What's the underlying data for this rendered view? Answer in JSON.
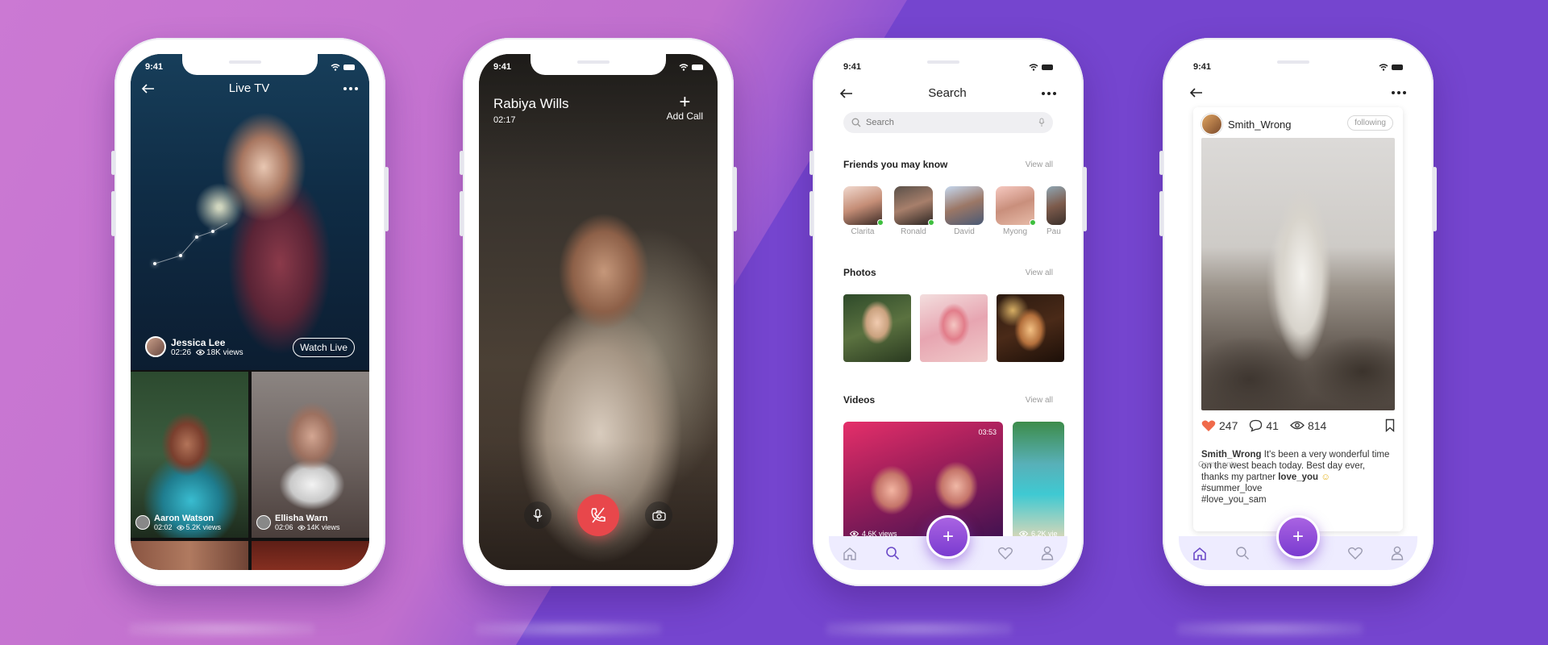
{
  "status_time": "9:41",
  "live_tv": {
    "title": "Live TV",
    "streamer_name": "Jessica Lee",
    "stream_time": "02:26",
    "stream_views": "18K views",
    "watch_label": "Watch Live",
    "tiles": [
      {
        "name": "Aaron Watson",
        "time": "02:02",
        "views": "5.2K views"
      },
      {
        "name": "Ellisha Warn",
        "time": "02:06",
        "views": "14K views"
      }
    ]
  },
  "call": {
    "name": "Rabiya Wills",
    "duration": "02:17",
    "add_call_label": "Add Call"
  },
  "search": {
    "title": "Search",
    "placeholder": "Search",
    "friends_title": "Friends you may know",
    "photos_title": "Photos",
    "videos_title": "Videos",
    "view_all": "View all",
    "friends": [
      "Clarita",
      "Ronald",
      "David",
      "Myong",
      "Pau"
    ],
    "videos": [
      {
        "duration": "03:53",
        "views": "4.6K views"
      },
      {
        "duration": "",
        "views": "6.2K vie"
      }
    ]
  },
  "post": {
    "username": "Smith_Wrong",
    "follow_label": "following",
    "likes": "247",
    "comments_count": "41",
    "views": "814",
    "caption_user": "Smith_Wrong",
    "caption_text": " It's been a very wonderful time on the west beach today. Best day ever, thanks my partner ",
    "caption_mention": "love_you",
    "tag1": "#summer_love",
    "tag2": "#love_you_sam",
    "comments_label": "Comments"
  },
  "colors": {
    "accent": "#8a4fd8",
    "end_call": "#e8474b",
    "like": "#f06a4a",
    "online": "#3fbf3f"
  },
  "icons": [
    "back-arrow-icon",
    "more-icon",
    "eye-icon",
    "plus-icon",
    "mic-icon",
    "end-call-icon",
    "camera-icon",
    "search-icon",
    "home-icon",
    "heart-icon",
    "user-icon",
    "comment-icon",
    "bookmark-icon",
    "wifi-icon",
    "battery-icon"
  ]
}
